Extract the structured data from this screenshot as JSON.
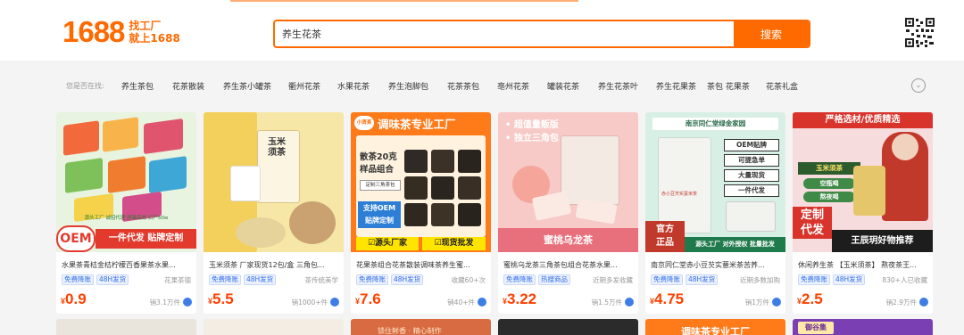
{
  "header": {
    "logo_number": "1688",
    "logo_line1": "找工厂",
    "logo_line2": "就上1688",
    "search_value": "养生花茶",
    "search_button": "搜索"
  },
  "hints": {
    "label": "您是否在找:",
    "items": [
      "养生茶包",
      "花茶散装",
      "养生茶小罐茶",
      "衢州花茶",
      "水果花茶",
      "养生泡脚包",
      "花茶茶包",
      "亳州花茶",
      "罐装花茶",
      "养生花茶叶",
      "养生花果茶",
      "茶包 花果茶",
      "花茶礼盒"
    ]
  },
  "products": [
    {
      "title": "水果茶青桔金桔柠檬百香果茶水果...",
      "tags": [
        "免费降账",
        "48H发货"
      ],
      "aside": "花果茶德",
      "price": "0.9",
      "sold": "销3.1万件",
      "image": {
        "band1": "OEM",
        "band2": "一件代发  贴牌定制",
        "small": "源头工厂  诚招代理  原装高效  日产50w"
      }
    },
    {
      "title": "玉米须茶 厂家现货12包/盒 三角包...",
      "tags": [
        "免费降账",
        "48H发货"
      ],
      "aside": "茶传统美学",
      "price": "5.5",
      "sold": "销1000+件",
      "image": {
        "box_text": "玉米须茶"
      }
    },
    {
      "title": "花果茶组合花茶散装调味茶养生蜜...",
      "tags": [
        "免费降账",
        "48H发货"
      ],
      "aside": "收藏60+次",
      "price": "7.6",
      "sold": "销40+件",
      "image": {
        "logo": "小贤茶",
        "heading": "调味茶专业工厂",
        "sample1": "散茶20克",
        "sample2": "样品组合",
        "sample3": "定制三角茶包",
        "oem1": "支持OEM",
        "oem2": "贴牌定制",
        "bottom1": "☑源头厂家",
        "bottom2": "☑现货批发"
      }
    },
    {
      "title": "蜜桃乌龙茶三角茶包组合花茶水果...",
      "tags": [
        "免费降账",
        "热搜商品"
      ],
      "aside": "近期多发收藏",
      "price": "3.22",
      "sold": "销1.5万件",
      "image": {
        "line1": "• 超值量贩版",
        "line2": "• 独立三角包",
        "banner": "蜜桃乌龙茶"
      }
    },
    {
      "title": "南京同仁堂赤小豆芡实薏米茶苦荞...",
      "tags": [
        "免费降账",
        "48H发货"
      ],
      "aside": "近期多数加购",
      "price": "4.75",
      "sold": "销1万件",
      "image": {
        "top": "南京同仁堂绿金家园",
        "b1": "OEM贴牌",
        "b2": "可提急单",
        "b3": "大量现货",
        "b4": "一件代发",
        "product": "赤小豆芡实薏米茶",
        "corner1": "官方",
        "corner2": "正品",
        "footer": "源头工厂  对外授权  批量批发"
      }
    },
    {
      "title": "休闲养生茶 【玉米须茶】 熬夜茶王...",
      "tags": [
        "免费降账",
        "48H发货"
      ],
      "aside": "830+人已收藏",
      "price": "2.5",
      "sold": "销2.9万件",
      "image": {
        "heading": "严格选材/优质精选",
        "box1": "玉米须茶",
        "box2": "空瓶喝",
        "box3": "熬夜喝",
        "left1": "定制",
        "left2": "代发",
        "banner": "王辰玥好物推荐"
      }
    }
  ],
  "row2": [
    "",
    "",
    "锁住鲜香 · 精心制作",
    "",
    "调味茶专业工厂",
    "御谷集"
  ],
  "colors": {
    "accent": "#ff6a00",
    "price": "#ff4000",
    "tag": "#2f6ee8"
  }
}
